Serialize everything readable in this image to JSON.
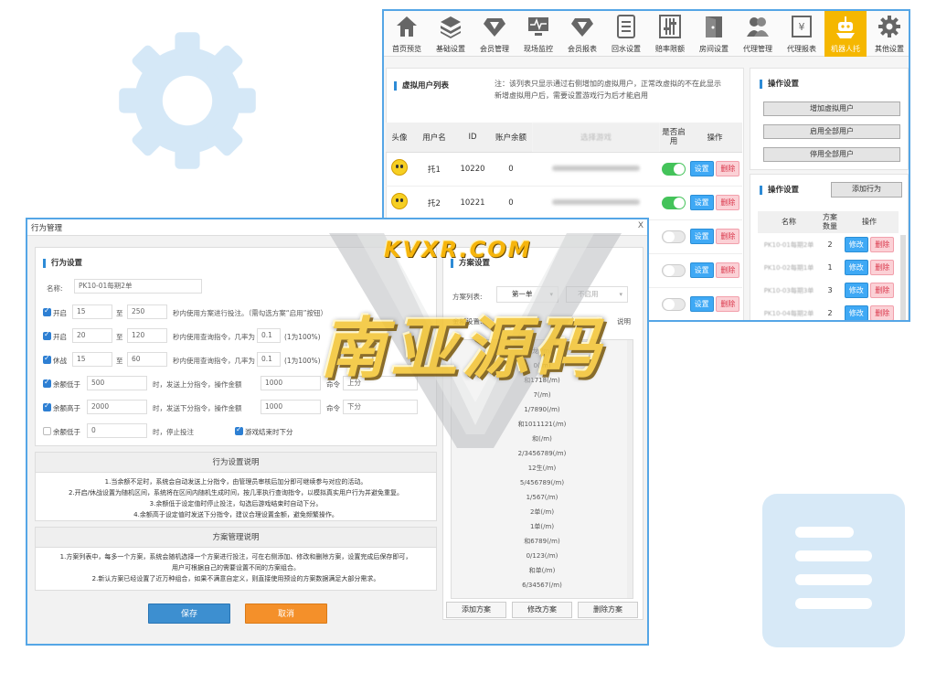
{
  "colors": {
    "accent": "#2d8bd6",
    "active_tab": "#f5b700",
    "window_border": "#55a6e6",
    "save": "#3d8fd0",
    "cancel": "#f4902a",
    "toggle_on": "#44c35a"
  },
  "nav": [
    {
      "label": "首页预览",
      "icon": "home-icon"
    },
    {
      "label": "基础设置",
      "icon": "layers-icon"
    },
    {
      "label": "会员管理",
      "icon": "diamond-icon"
    },
    {
      "label": "现场监控",
      "icon": "monitor-icon"
    },
    {
      "label": "会员报表",
      "icon": "diamond-icon"
    },
    {
      "label": "回水设置",
      "icon": "document-icon"
    },
    {
      "label": "赔率限额",
      "icon": "sliders-icon"
    },
    {
      "label": "房间设置",
      "icon": "door-icon"
    },
    {
      "label": "代理管理",
      "icon": "users-icon"
    },
    {
      "label": "代理报表",
      "icon": "report-icon"
    },
    {
      "label": "机器人托",
      "icon": "robot-icon",
      "active": true
    },
    {
      "label": "其他设置",
      "icon": "gear-icon"
    }
  ],
  "virtual": {
    "title": "虚拟用户列表",
    "note_line1": "注：该列表只显示通过右侧增加的虚拟用户，正常改虚拟的不在此显示",
    "note_line2": "新增虚拟用户后，需要设置游戏行为后才能启用",
    "headers": [
      "头像",
      "用户名",
      "ID",
      "账户余额",
      "选择游戏",
      "是否启用",
      "操作"
    ],
    "rows": [
      {
        "name": "托1",
        "id": "10220",
        "balance": "0",
        "enabled": true
      },
      {
        "name": "托2",
        "id": "10221",
        "balance": "0",
        "enabled": true
      },
      {
        "name": "",
        "id": "",
        "balance": "",
        "enabled": false
      },
      {
        "name": "",
        "id": "",
        "balance": "",
        "enabled": false
      },
      {
        "name": "",
        "id": "",
        "balance": "",
        "enabled": false
      }
    ],
    "set_label": "设置",
    "delete_label": "删除"
  },
  "op_settings": {
    "title": "操作设置",
    "add_virtual": "增加虚拟用户",
    "enable_all": "启用全部用户",
    "disable_all": "停用全部用户"
  },
  "op_settings2": {
    "title": "操作设置",
    "add_behavior": "添加行为",
    "headers": [
      "名称",
      "方案数量",
      "操作"
    ],
    "rows": [
      {
        "name": "PK10-01每期2单",
        "count": "2"
      },
      {
        "name": "PK10-02每期1单",
        "count": "1"
      },
      {
        "name": "PK10-03每期3单",
        "count": "3"
      },
      {
        "name": "PK10-04每期2单",
        "count": "2"
      }
    ],
    "edit_label": "修改",
    "delete_label": "删除"
  },
  "dialog": {
    "title": "行为管理",
    "close": "X",
    "behavior_title": "行为设置",
    "name_label": "名称:",
    "name_value": "PK10-01每期2单",
    "row1": {
      "label": "开启",
      "v1": "15",
      "to": "至",
      "v2": "250",
      "desc": "秒内使用方案进行投注。（需勾选方案“启用”按钮）"
    },
    "row2": {
      "label": "开启",
      "v1": "20",
      "to": "至",
      "v2": "120",
      "desc": "秒内使用查询指令，几率为",
      "v3": "0.1",
      "desc2": "(1为100%)"
    },
    "row3": {
      "label": "休战",
      "v1": "15",
      "to": "至",
      "v2": "60",
      "desc": "秒内使用查询指令，几率为",
      "v3": "0.1",
      "desc2": "(1为100%)"
    },
    "row4": {
      "label": "余额低于",
      "v1": "500",
      "desc": "时，发送上分指令，操作金额",
      "v2": "1000",
      "cmd": "命令",
      "v3": "上分"
    },
    "row5": {
      "label": "余额高于",
      "v1": "2000",
      "desc": "时，发送下分指令，操作金额",
      "v2": "1000",
      "cmd": "命令",
      "v3": "下分"
    },
    "row6": {
      "label": "余额低于",
      "v1": "0",
      "desc": "时，停止投注",
      "extra": "游戏结束时下分"
    },
    "behavior_desc_title": "行为设置说明",
    "behavior_desc": [
      "1.当余额不足时，系统会自动发送上分指令，由管理员审核后加分即可继续参与对应的活动。",
      "2.开启/休战设置为随机区间，系统将在区间内随机生成时间，按几率执行查询指令，以模拟真实用户行为并避免重复。",
      "3.余额低于设定值时停止投注，勾选后游戏结束时自动下分。",
      "4.余额高于设定值时发送下分指令，建议合理设置金额，避免频繁操作。"
    ],
    "plan_desc_title": "方案管理说明",
    "plan_desc": [
      "1.方案列表中，每多一个方案，系统会随机选择一个方案进行投注，可在右侧添加、修改和删除方案，设置完成后保存即可，",
      "用户可根据自己的需要设置不同的方案组合。",
      "2.新认方案已经设置了近万种组合，如果不满意自定义，则直接使用预设的方案数据满足大部分需求。"
    ],
    "save": "保存",
    "cancel": "取消",
    "plan_title": "方案设置",
    "plan_list_label": "方案列表:",
    "plan_list_value": "第一单",
    "plan_list_value2": "不启用",
    "amount_label": "金额设置:",
    "amount_hint": "说明",
    "plans": [
      "龙(/m)",
      "0(/m)",
      "和1718(/m)",
      "7(/m)",
      "1/7890(/m)",
      "和1011121(/m)",
      "和(/m)",
      "2/3456789(/m)",
      "12生(/m)",
      "5/456789(/m)",
      "1/567(/m)",
      "2单(/m)",
      "1单(/m)",
      "和6789(/m)",
      "0/123(/m)",
      "和单(/m)",
      "6/34567(/m)"
    ],
    "add_plan": "添加方案",
    "edit_plan": "修改方案",
    "delete_plan": "删除方案"
  },
  "watermark": {
    "line1": "KVXR.COM",
    "line2": "南亚源码"
  }
}
